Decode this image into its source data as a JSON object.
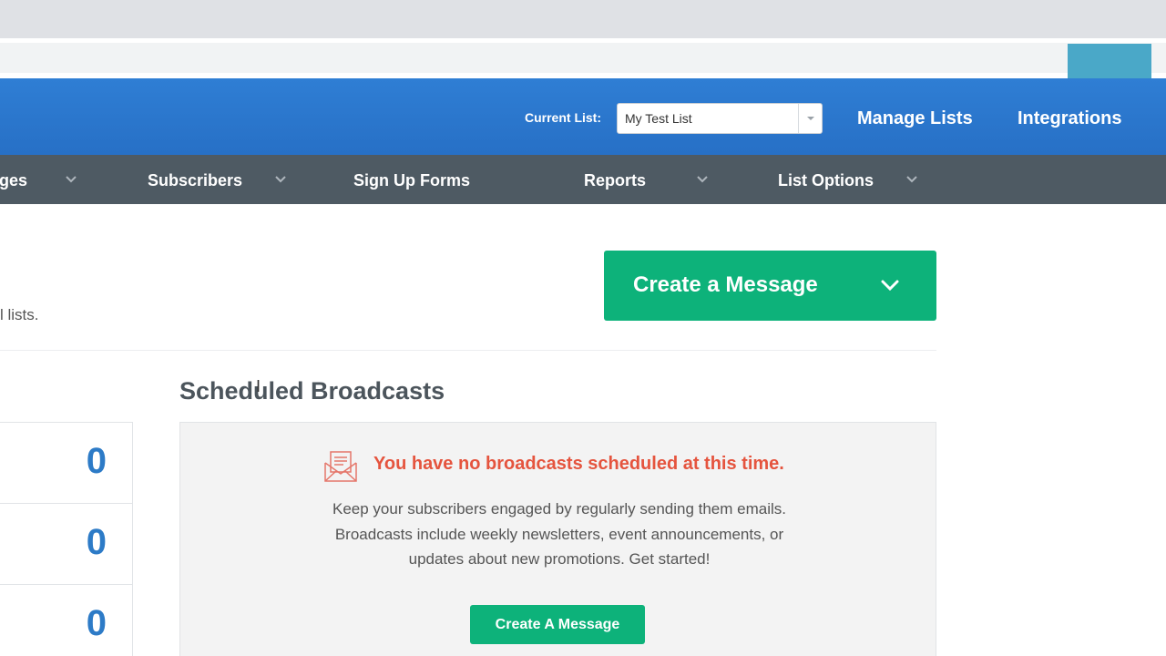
{
  "header": {
    "current_list_label": "Current List:",
    "current_list_value": "My Test List",
    "manage_lists": "Manage Lists",
    "integrations": "Integrations"
  },
  "nav": {
    "items": [
      {
        "label": "ges",
        "has_dropdown": true
      },
      {
        "label": "Subscribers",
        "has_dropdown": true
      },
      {
        "label": "Sign Up Forms",
        "has_dropdown": false
      },
      {
        "label": "Reports",
        "has_dropdown": true
      },
      {
        "label": "List Options",
        "has_dropdown": true
      }
    ]
  },
  "main": {
    "lists_text": "l lists.",
    "create_message_label": "Create a Message",
    "section_title": "Scheduled Broadcasts",
    "stats": [
      "0",
      "0",
      "0"
    ],
    "empty_state": {
      "title": "You have no broadcasts scheduled at this time.",
      "description": "Keep your subscribers engaged by regularly sending them emails. Broadcasts include weekly newsletters, event announcements, or updates about new promotions. Get started!",
      "button_label": "Create A Message"
    }
  },
  "colors": {
    "header_blue": "#2f7ed4",
    "nav_dark": "#4e5a63",
    "action_green": "#0db27a",
    "alert_red": "#e5543e",
    "stat_blue": "#2d7bc7"
  },
  "icons": {
    "dropdown": "chevron-down-icon",
    "empty_state": "envelope-letter-icon",
    "select_arrow": "caret-down-icon"
  }
}
